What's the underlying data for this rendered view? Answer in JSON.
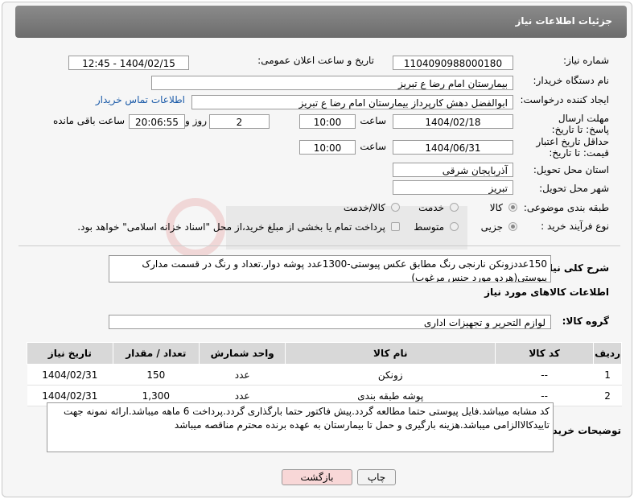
{
  "header": {
    "title": "جزئیات اطلاعات نیاز"
  },
  "fields": {
    "need_number_label": "شماره نیاز:",
    "need_number": "1104090988000180",
    "announce_label": "تاریخ و ساعت اعلان عمومی:",
    "announce_value": "1404/02/15 - 12:45",
    "buyer_org_label": "نام دستگاه خریدار:",
    "buyer_org": "بیمارستان امام رضا  ع  تبریز",
    "creator_label": "ایجاد کننده درخواست:",
    "creator": "ابوالفضل دهش کارپرداز بیمارستان امام رضا  ع  تبریز",
    "contact_link": "اطلاعات تماس خریدار",
    "deadline_label": "مهلت ارسال پاسخ: تا تاریخ:",
    "deadline_date": "1404/02/18",
    "time_label": "ساعت",
    "deadline_time": "10:00",
    "days_value": "2",
    "days_label": "روز و",
    "remaining_time": "20:06:55",
    "remaining_label": "ساعت باقی مانده",
    "validity_label": "حداقل تاریخ اعتبار قیمت: تا تاریخ:",
    "validity_date": "1404/06/31",
    "validity_time": "10:00",
    "province_label": "استان محل تحویل:",
    "province": "آذربایجان شرقی",
    "city_label": "شهر محل تحویل:",
    "city": "تبریز",
    "category_label": "طبقه بندی موضوعی:",
    "category_options": [
      "کالا",
      "خدمت",
      "کالا/خدمت"
    ],
    "category_selected": "کالا",
    "process_label": "نوع فرآیند خرید :",
    "process_options": [
      "جزیی",
      "متوسط"
    ],
    "process_selected": "جزیی",
    "payment_note": "پرداخت تمام یا بخشی از مبلغ خرید،از محل \"اسناد خزانه اسلامی\" خواهد بود."
  },
  "summary": {
    "label": "شرح کلی نیاز:",
    "text": "150عددزونکن نارنجی رنگ مطابق عکس پیوستی-1300عدد پوشه دوار.تعداد و رنگ در قسمت مدارک پیوستی(هردو مورد جنس مرغوب)"
  },
  "goods_section_title": "اطلاعات کالاهای مورد نیاز",
  "goods_group": {
    "label": "گروه کالا:",
    "value": "لوازم التحریر و تجهیزات اداری"
  },
  "table": {
    "headers": [
      "ردیف",
      "کد کالا",
      "نام کالا",
      "واحد شمارش",
      "تعداد / مقدار",
      "تاریخ نیاز"
    ],
    "rows": [
      [
        "1",
        "--",
        "زونکن",
        "عدد",
        "150",
        "1404/02/31"
      ],
      [
        "2",
        "--",
        "پوشه طبقه بندی",
        "عدد",
        "1,300",
        "1404/02/31"
      ]
    ]
  },
  "buyer_notes": {
    "label": "توضیحات خریدار:",
    "text": "کد مشابه میباشد.فایل پیوستی حتما مطالعه گردد.پیش فاکتور حتما بارگذاری گردد.پرداخت 6 ماهه میباشد.ارائه نمونه جهت تاییدکالاالزامی میباشد.هزینه بارگیری و حمل تا بیمارستان به عهده برنده محترم مناقصه میباشد"
  },
  "buttons": {
    "print": "چاپ",
    "back": "بازگشت"
  },
  "colors": {
    "header_bg": "#7a7a7a",
    "link": "#1a5aa8",
    "back_button_bg": "#f8d7d7"
  }
}
